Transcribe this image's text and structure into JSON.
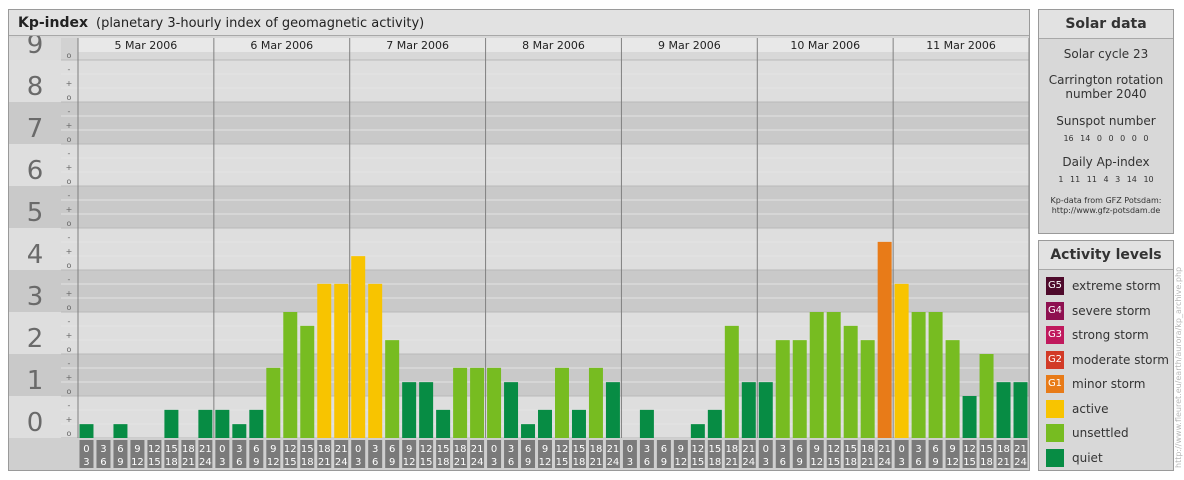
{
  "header": {
    "title": "Kp-index",
    "subtitle": "(planetary 3-hourly index of geomagnetic activity)"
  },
  "colors": {
    "quiet": "#078c44",
    "unsettled": "#77bc21",
    "active": "#f8c400",
    "minor_storm": "#e87b18",
    "moderate_storm": "#d23a26",
    "strong_storm": "#c0195d",
    "severe_storm": "#8e1050",
    "extreme_storm": "#4e0a2b"
  },
  "chart_data": {
    "type": "bar",
    "title": "Kp-index",
    "subtitle": "(planetary 3-hourly index of geomagnetic activity)",
    "ylim": [
      0,
      9
    ],
    "y_ticks": [
      "0",
      "1",
      "2",
      "3",
      "4",
      "5",
      "6",
      "7",
      "8",
      "9"
    ],
    "minor_tick_labels": [
      "o",
      "+",
      "-"
    ],
    "days": [
      "5 Mar 2006",
      "6 Mar 2006",
      "7 Mar 2006",
      "8 Mar 2006",
      "9 Mar 2006",
      "10 Mar 2006",
      "11 Mar 2006"
    ],
    "interval_start_labels": [
      "0",
      "3",
      "6",
      "9",
      "12",
      "15",
      "18",
      "21"
    ],
    "interval_end_labels": [
      "3",
      "6",
      "9",
      "12",
      "15",
      "18",
      "21",
      "24"
    ],
    "values": [
      [
        0.33,
        0,
        0.33,
        0,
        0,
        0.67,
        0,
        0.67
      ],
      [
        0.67,
        0.33,
        0.67,
        1.67,
        3,
        2.67,
        3.67,
        3.67
      ],
      [
        4.33,
        3.67,
        2.33,
        1.33,
        1.33,
        0.67,
        1.67,
        1.67
      ],
      [
        1.67,
        1.33,
        0.33,
        0.67,
        1.67,
        0.67,
        1.67,
        1.33
      ],
      [
        0,
        0.67,
        0,
        0,
        0.33,
        0.67,
        2.67,
        1.33
      ],
      [
        1.33,
        2.33,
        2.33,
        3,
        3,
        2.67,
        2.33,
        4.67
      ],
      [
        3.67,
        3,
        3,
        2.33,
        1,
        2,
        1.33,
        1.33
      ]
    ],
    "grid": true
  },
  "solar": {
    "title": "Solar data",
    "cycle": "Solar cycle 23",
    "carrington_line1": "Carrington rotation",
    "carrington_line2": "number 2040",
    "sunspot_label": "Sunspot number",
    "sunspot_values": "16 14 0 0 0 0 0",
    "ap_label": "Daily Ap-index",
    "ap_values": "1 11 11 4 3 14 10",
    "source_line1": "Kp-data from GFZ Potsdam:",
    "source_line2": "http://www.gfz-potsdam.de"
  },
  "activity": {
    "title": "Activity levels",
    "levels": [
      {
        "code": "G5",
        "label": "extreme storm",
        "color": "#4e0a2b"
      },
      {
        "code": "G4",
        "label": "severe storm",
        "color": "#8e1050"
      },
      {
        "code": "G3",
        "label": "strong storm",
        "color": "#c0195d"
      },
      {
        "code": "G2",
        "label": "moderate storm",
        "color": "#d23a26"
      },
      {
        "code": "G1",
        "label": "minor storm",
        "color": "#e87b18"
      },
      {
        "code": "",
        "label": "active",
        "color": "#f8c400"
      },
      {
        "code": "",
        "label": "unsettled",
        "color": "#77bc21"
      },
      {
        "code": "",
        "label": "quiet",
        "color": "#078c44"
      }
    ]
  },
  "side_url": "http://www.fleuret.eu/earth/aurora/kp_archive.php"
}
